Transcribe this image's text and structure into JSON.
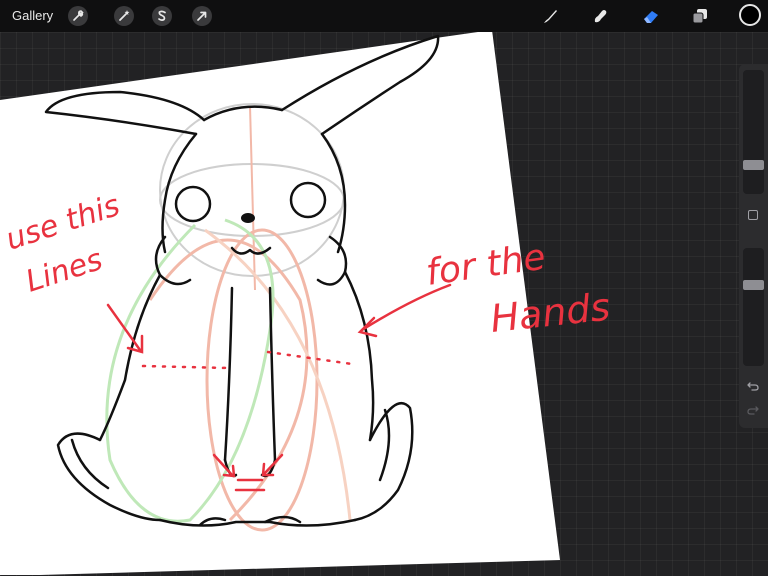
{
  "toolbar": {
    "gallery_label": "Gallery",
    "actions_icon": "wrench-icon",
    "adjustments_icon": "magic-wand-icon",
    "selection_icon": "selection-s-icon",
    "transform_icon": "arrow-cursor-icon",
    "brush_icon": "brush-icon",
    "smudge_icon": "smudge-icon",
    "eraser_icon": "eraser-icon",
    "layers_icon": "layers-icon",
    "active_tool": "eraser",
    "active_color": "#2f7cf6",
    "current_color": "#000000"
  },
  "sidebar": {
    "brush_size_slider": "brush-size-slider",
    "opacity_slider": "brush-opacity-slider",
    "modify_button": "square-modify-icon",
    "undo_icon": "undo-icon",
    "redo_icon": "redo-icon"
  },
  "canvas": {
    "annotation_left_line1": "use this",
    "annotation_left_line2": "Lines",
    "annotation_right_line1": "for the",
    "annotation_right_line2": "Hands",
    "ink_color": "#e8323f",
    "guide_pink": "#f2b8a8",
    "guide_green": "#bfe8b8",
    "guide_gray": "#cfcfcf"
  }
}
